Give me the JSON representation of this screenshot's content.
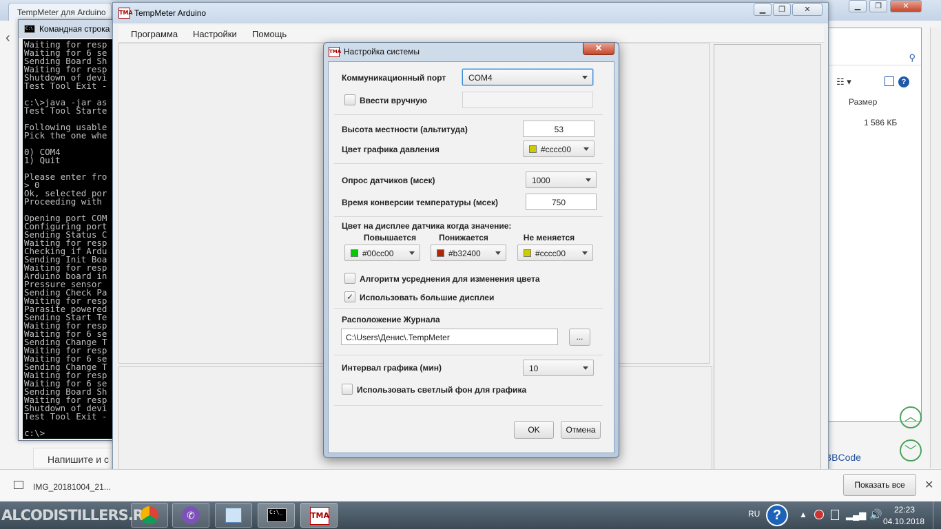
{
  "browser": {
    "tab_label": "TempMeter для Arduino",
    "explorer_col_size": "Размер",
    "explorer_size_value": "1 586 КБ",
    "comment_placeholder": "Напишите и с",
    "bbcode_label": "BBCode",
    "download_file": "IMG_20181004_21...",
    "show_all_label": "Показать все"
  },
  "cmd": {
    "title": "Командная строка",
    "lines": "Waiting for resp\nWaiting for 6 se\nSending Board Sh\nWaiting for resp\nShutdown of devi\nTest Tool Exit -\n\nc:\\>java -jar as\nTest Tool Starte\n\nFollowing usable\nPick the one whe\n\n0) COM4\n1) Quit\n\nPlease enter fro\n> 0\nOk, selected por\nProceeding with\n\nOpening port COM\nConfiguring port\nSending Status C\nWaiting for resp\nChecking if Ardu\nSending Init Boa\nWaiting for resp\nArduino board in\nPressure sensor\nSending Check Pa\nWaiting for resp\nParasite powered\nSending Start Te\nWaiting for resp\nWaiting for 6 se\nSending Change T\nWaiting for resp\nWaiting for 6 se\nSending Change T\nWaiting for resp\nWaiting for 6 se\nSending Board Sh\nWaiting for resp\nShutdown of devi\nTest Tool Exit -\n\nc:\\>"
  },
  "main_window": {
    "title": "TempMeter Arduino",
    "menu": [
      "Программа",
      "Настройки",
      "Помощь"
    ]
  },
  "dialog": {
    "title": "Настройка системы",
    "close_glyph": "✕",
    "comm_port_label": "Коммуникационный порт",
    "comm_port_value": "COM4",
    "manual_entry_label": "Ввести вручную",
    "manual_entry_checked": false,
    "manual_entry_value": "",
    "altitude_label": "Высота местности (альтитуда)",
    "altitude_value": "53",
    "pressure_color_label": "Цвет графика давления",
    "pressure_color_value": "#cccc00",
    "poll_label": "Опрос датчиков (мсек)",
    "poll_value": "1000",
    "conversion_label": "Время конверсии температуры (мсек)",
    "conversion_value": "750",
    "display_color_label": "Цвет на дисплее датчика когда значение:",
    "rising_label": "Повышается",
    "rising_value": "#00cc00",
    "falling_label": "Понижается",
    "falling_value": "#b32400",
    "steady_label": "Не меняется",
    "steady_value": "#cccc00",
    "averaging_label": "Алгоритм усреднения для изменения цвета",
    "averaging_checked": false,
    "large_displays_label": "Использовать большие дисплеи",
    "large_displays_checked": true,
    "log_location_label": "Расположение Журнала",
    "log_location_value": "C:\\Users\\Денис\\.TempMeter",
    "browse_label": "...",
    "graph_interval_label": "Интервал графика (мин)",
    "graph_interval_value": "10",
    "light_bg_label": "Использовать светлый фон для графика",
    "light_bg_checked": false,
    "ok_label": "OK",
    "cancel_label": "Отмена"
  },
  "taskbar": {
    "watermark": "ALCODISTILLERS.RU",
    "lang": "RU",
    "time": "22:23",
    "date": "04.10.2018"
  },
  "colors": {
    "green": "#00cc00",
    "red": "#b32400",
    "yellow": "#cccc00"
  }
}
